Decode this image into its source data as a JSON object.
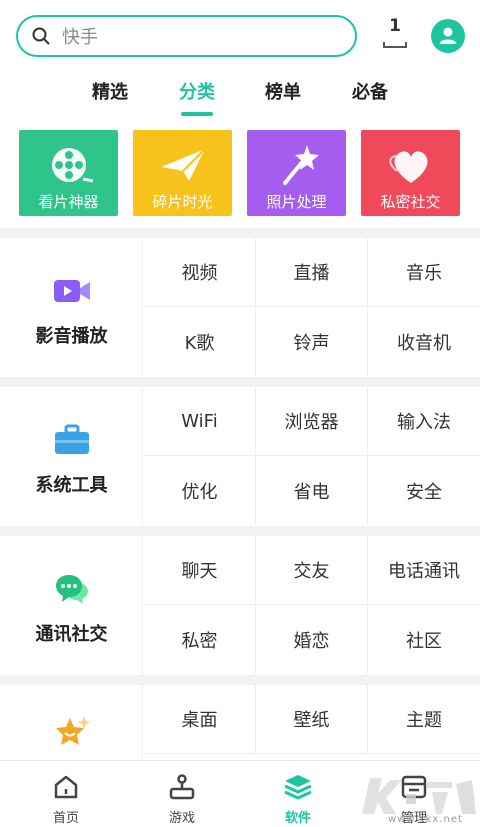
{
  "search": {
    "placeholder": "快手"
  },
  "header": {
    "download_count": "1"
  },
  "tabs": [
    {
      "label": "精选"
    },
    {
      "label": "分类"
    },
    {
      "label": "榜单"
    },
    {
      "label": "必备"
    }
  ],
  "active_tab": "分类",
  "feature_cards": [
    {
      "label": "看片神器",
      "color": "#2fc48a",
      "icon": "film-reel-icon"
    },
    {
      "label": "碎片时光",
      "color": "#f7c21a",
      "icon": "paper-plane-icon"
    },
    {
      "label": "照片处理",
      "color": "#a55df0",
      "icon": "magic-wand-icon"
    },
    {
      "label": "私密社交",
      "color": "#f0495a",
      "icon": "hearts-icon"
    }
  ],
  "sections": [
    {
      "title": "影音播放",
      "icon": "video-camera-icon",
      "icon_color": "#8b5cf6",
      "items": [
        "视频",
        "直播",
        "音乐",
        "K歌",
        "铃声",
        "收音机"
      ]
    },
    {
      "title": "系统工具",
      "icon": "toolbox-icon",
      "icon_color": "#3aa0e8",
      "items": [
        "WiFi",
        "浏览器",
        "输入法",
        "优化",
        "省电",
        "安全"
      ]
    },
    {
      "title": "通讯社交",
      "icon": "chat-bubbles-icon",
      "icon_color": "#22c17d",
      "items": [
        "聊天",
        "交友",
        "电话通讯",
        "私密",
        "婚恋",
        "社区"
      ]
    },
    {
      "title": "",
      "icon": "star-face-icon",
      "icon_color": "#f5a623",
      "items": [
        "桌面",
        "壁纸",
        "主题"
      ]
    }
  ],
  "bottom_nav": [
    {
      "label": "首页",
      "icon": "home-icon"
    },
    {
      "label": "游戏",
      "icon": "joystick-icon"
    },
    {
      "label": "软件",
      "icon": "layers-icon"
    },
    {
      "label": "管理",
      "icon": "manage-box-icon"
    }
  ],
  "active_nav": "软件",
  "watermark": {
    "text": "www.kkx.net"
  },
  "colors": {
    "accent": "#1cc5a0",
    "divider": "#f2f2f2"
  }
}
